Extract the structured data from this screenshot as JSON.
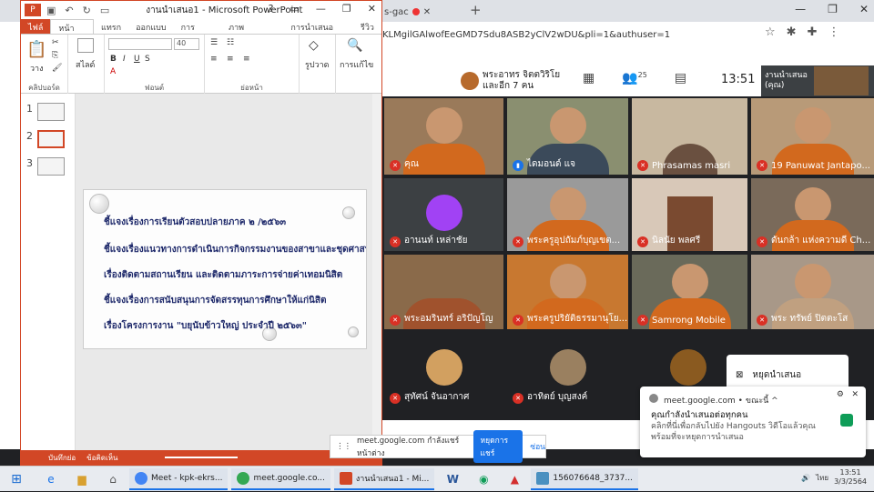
{
  "browser": {
    "tab_fragment": "s-gac",
    "new_tab": "+",
    "url": "KLMgilGAlwofEeGMD7Sdu8ASB2yClV2wDU&pli=1&authuser=1",
    "win_min": "—",
    "win_max": "❐",
    "win_close": "✕"
  },
  "ppt": {
    "logo": "P",
    "title": "งานนำเสนอ1 - Microsoft PowerPoint",
    "help": "?",
    "min": "—",
    "max": "❐",
    "close": "✕",
    "tabs": [
      "ไฟล์",
      "หน้าแรก",
      "แทรก",
      "ออกแบบ",
      "การเปลี่ยน",
      "ภาพเคลื่อนไหว",
      "การนำเสนอสไลด์",
      "รีวิว"
    ],
    "ribbon": {
      "paste": "วาง",
      "clipboard": "คลิปบอร์ด",
      "slide": "สไลด์",
      "font_size": "40",
      "font": "ฟอนต์",
      "paragraph": "ย่อหน้า",
      "shapes": "รูปวาด",
      "editing": "การแก้ไข"
    },
    "thumbs": [
      "1",
      "2",
      "3"
    ],
    "bullets": [
      "ชี้แจงเรื่องการเรียนตัวสอบปลายภาค ๒ /๒๕๖๓",
      "ชี้แจงเรื่องแนวทางการดำเนินการกิจกรรมงานของสาขาและชุดศาสนา",
      "เรื่องติดตามสถานเรียน และติดตามภาระการจ่ายค่าเทอมนิสิต",
      "ชี้แจงเรื่องการสนับสนุนการจัดสรรทุนการศึกษาให้แก่นิสิต",
      "เรื่องโครงการงาน \"บยุนับข้าวใหญ่ ประจำปี ๒๕๖๓\""
    ],
    "status_notes": "บันทึกย่อ",
    "status_comments": "ข้อคิดเห็น"
  },
  "meet": {
    "presenting": "พระอาทร จิตตวิริโย\nและอีก 7 คน",
    "people_count": "25",
    "clock": "13:51",
    "you_presenting": "งานนำเสนอ\n(คุณ)",
    "you_label": "คุณ",
    "participants": [
      {
        "name": "คุณ",
        "mic": "muted"
      },
      {
        "name": "ไดมอนด์ แจ",
        "mic": "on"
      },
      {
        "name": "Phrasamas masri",
        "mic": "muted"
      },
      {
        "name": "19 Panuwat Jantapo...",
        "mic": "muted"
      },
      {
        "name": "อานนท์ เหล่าชัย",
        "mic": "muted"
      },
      {
        "name": "พระครูอุปถัมภ์บุญเขต...",
        "mic": "muted"
      },
      {
        "name": "นิลนัย พลศรี",
        "mic": "muted"
      },
      {
        "name": "ดันกล้า แห่งความดี Ch...",
        "mic": "muted"
      },
      {
        "name": "พระอมรินทร์ อริปัญโญ",
        "mic": "muted"
      },
      {
        "name": "พระครูปริยัติธรรมานุโย...",
        "mic": "muted"
      },
      {
        "name": "Samrong Mobile",
        "mic": "muted"
      },
      {
        "name": "พระ ทรัพย์ ปิตตะโส",
        "mic": "muted"
      },
      {
        "name": "สุทัศน์ จันอากาศ",
        "mic": "muted"
      },
      {
        "name": "อาทิตย์ บุญสงค์",
        "mic": "muted"
      }
    ],
    "stop_presenting": "หยุดนำเสนอ"
  },
  "share_bar": {
    "text": "meet.google.com กำลังแชร์หน้าต่าง",
    "stop": "หยุดการแชร์",
    "hide": "ซ่อน"
  },
  "notification": {
    "source": "meet.google.com • ขณะนี้ ^",
    "title": "คุณกำลังนำเสนอต่อทุกคน",
    "body": "คลิกที่นี่เพื่อกลับไปยัง Hangouts วิดีโอแล้วคุณพร้อมที่จะหยุดการนำเสนอ",
    "gear": "⚙",
    "close": "✕"
  },
  "taskbar": {
    "apps": [
      {
        "label": "Meet - kpk-ekrs...",
        "color": "#4285f4"
      },
      {
        "label": "meet.google.co...",
        "color": "#34a853"
      },
      {
        "label": "งานนำเสนอ1 - Mi...",
        "color": "#d24726"
      },
      {
        "label": "156076648_3737...",
        "color": "#4a90c0"
      }
    ],
    "lang": "ไทย",
    "time": "13:51",
    "date": "3/3/2564"
  }
}
